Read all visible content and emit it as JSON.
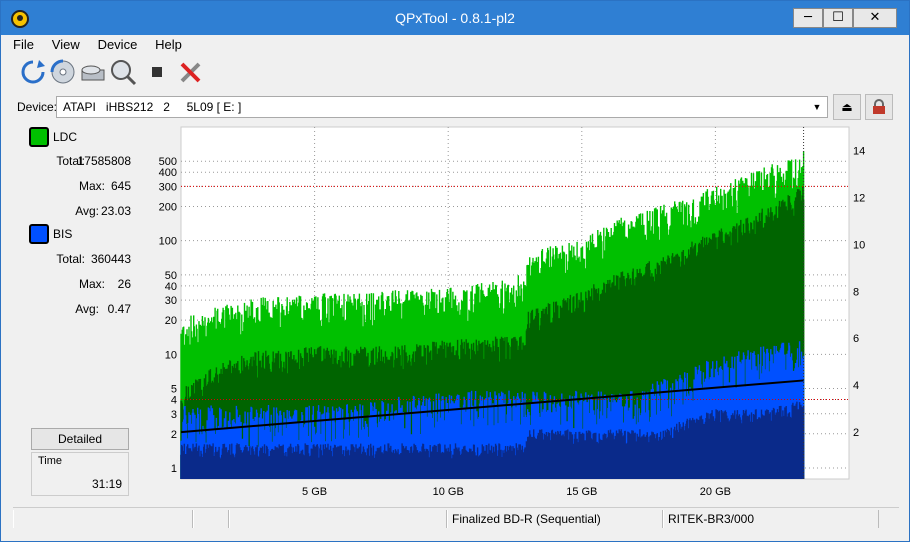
{
  "window": {
    "title": "QPxTool - 0.8.1-pl2",
    "minimize": "─",
    "maximize": "☐",
    "close": "✕"
  },
  "menu": {
    "file": "File",
    "view": "View",
    "device": "Device",
    "help": "Help"
  },
  "toolbar": {
    "icons": [
      "refresh-icon",
      "disc-info-icon",
      "scan-drive-icon",
      "test-search-icon",
      "stop-icon",
      "settings-tools-icon"
    ]
  },
  "device": {
    "label": "Device:",
    "selected": "ATAPI   iHBS212   2     5L09 [ E: ]"
  },
  "legend": {
    "ldc": {
      "name": "LDC",
      "color": "#00c000",
      "total_label": "Total:",
      "total": "17585808",
      "max_label": "Max:",
      "max": "645",
      "avg_label": "Avg:",
      "avg": "23.03"
    },
    "bis": {
      "name": "BIS",
      "color": "#0050ff",
      "total_label": "Total:",
      "total": "360443",
      "max_label": "Max:",
      "max": "26",
      "avg_label": "Avg:",
      "avg": "0.47"
    }
  },
  "detailed_button": "Detailed",
  "time": {
    "label": "Time",
    "value": "31:19"
  },
  "status": {
    "cell1": "",
    "cell2": "",
    "disc_type": "Finalized BD-R (Sequential)",
    "media_id": "RITEK-BR3/000"
  },
  "chart_data": {
    "type": "area",
    "x_ticks": [
      "5 GB",
      "10 GB",
      "15 GB",
      "20 GB"
    ],
    "x_tick_values": [
      5,
      10,
      15,
      20
    ],
    "xlim": [
      0,
      25
    ],
    "y_left_ticks": [
      "1",
      "2",
      "3",
      "4",
      "5",
      "10",
      "20",
      "30",
      "40",
      "50",
      "100",
      "200",
      "300",
      "400",
      "500"
    ],
    "y_left_values": [
      1,
      2,
      3,
      4,
      5,
      10,
      20,
      30,
      40,
      50,
      100,
      200,
      300,
      400,
      500
    ],
    "y_left_scale": "log",
    "y_left_lim": [
      0.8,
      1000
    ],
    "y_right_ticks": [
      "2",
      "4",
      "6",
      "8",
      "10",
      "12",
      "14"
    ],
    "y_right_values": [
      2,
      4,
      6,
      8,
      10,
      12,
      14
    ],
    "y_right_lim": [
      0,
      15
    ],
    "grid": true,
    "data_end_x": 23.3,
    "series": [
      {
        "name": "LDC",
        "color": "#00c000",
        "x": [
          0,
          1,
          2,
          3,
          4,
          5,
          6,
          7,
          8,
          9,
          10,
          11,
          12,
          12.9,
          13,
          14,
          15,
          15.5,
          16,
          17,
          18,
          19,
          20,
          21,
          22,
          23,
          23.3
        ],
        "peak": [
          18,
          22,
          25,
          28,
          28,
          30,
          30,
          30,
          32,
          32,
          34,
          36,
          40,
          45,
          70,
          80,
          90,
          110,
          130,
          150,
          180,
          220,
          260,
          320,
          400,
          500,
          550
        ],
        "base": [
          4,
          6,
          8,
          9,
          9,
          10,
          10,
          10,
          10,
          11,
          11,
          12,
          12,
          12,
          20,
          25,
          30,
          35,
          40,
          50,
          60,
          80,
          100,
          130,
          170,
          230,
          260
        ]
      },
      {
        "name": "BIS",
        "color": "#0050ff",
        "x": [
          0,
          2,
          4,
          6,
          8,
          10,
          12,
          12.9,
          13,
          14,
          15,
          16,
          17,
          18,
          19,
          20,
          21,
          22,
          23,
          23.3
        ],
        "peak": [
          3,
          3,
          3,
          3,
          3.5,
          4,
          4,
          4,
          4,
          4,
          4,
          4,
          4,
          5,
          6,
          8,
          9,
          10,
          12,
          13
        ],
        "base": [
          1.5,
          1.5,
          1.5,
          1.5,
          1.5,
          1.5,
          1.5,
          1.5,
          2,
          2,
          2,
          2,
          2,
          2,
          2.5,
          3,
          3,
          3,
          3.5,
          3.5
        ]
      }
    ],
    "speed_line": {
      "color": "#000000",
      "x": [
        0,
        23.3
      ],
      "y_right": [
        2.0,
        4.2
      ]
    }
  }
}
